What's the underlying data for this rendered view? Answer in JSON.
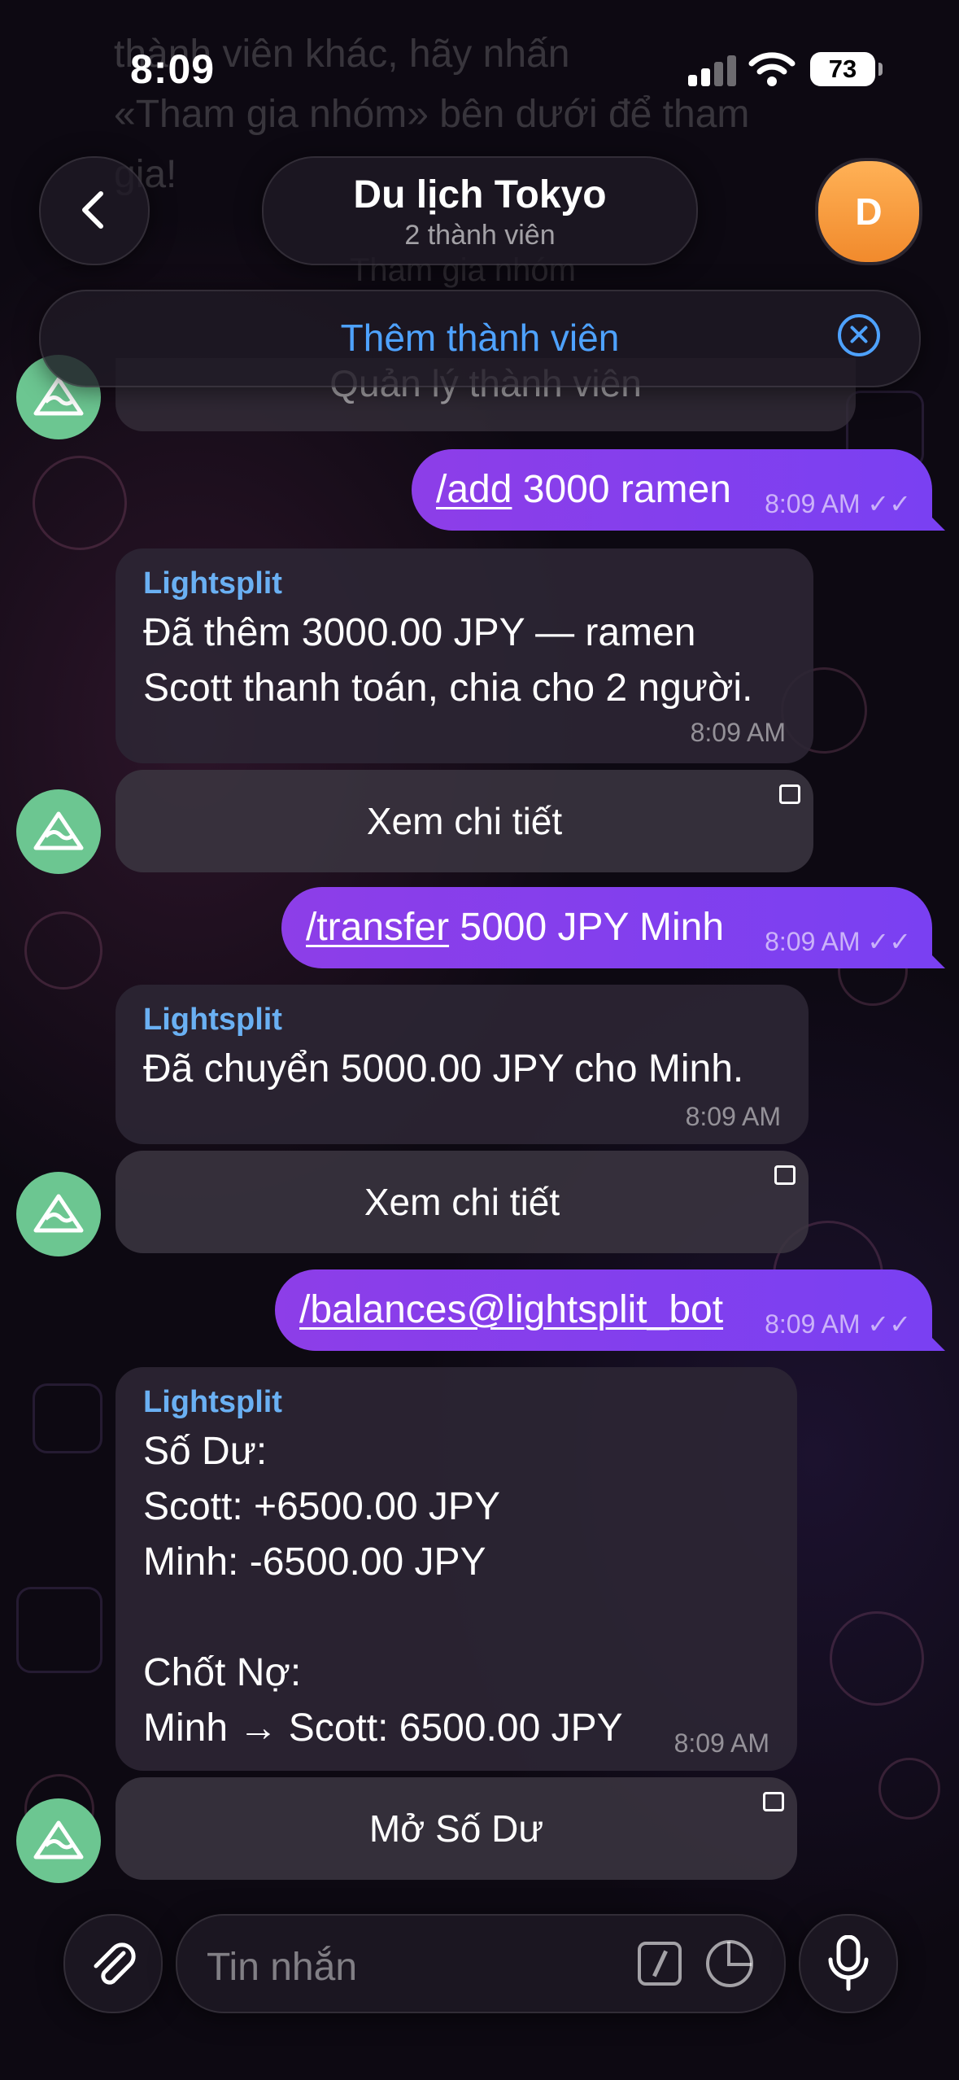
{
  "status_bar": {
    "time": "8:09",
    "battery": "73"
  },
  "pinned_ghost": {
    "line1": "thành viên khác, hãy nhấn",
    "line2": "«Tham gia nhóm» bên dưới để tham",
    "line3": "gia!",
    "button": "Tham gia nhóm"
  },
  "header": {
    "back_icon": "chevron-left-icon",
    "title": "Du lịch Tokyo",
    "subtitle": "2 thành viên",
    "avatar_letter": "D",
    "avatar_color": "#f5a042"
  },
  "add_member_bar": {
    "label": "Thêm thành viên",
    "close_icon": "close-circle-icon",
    "accent": "#4ea2ff"
  },
  "previous_button": {
    "label": "Quản lý thành viên"
  },
  "messages": [
    {
      "type": "outgoing",
      "command": "/add",
      "rest": " 3000 ramen",
      "time": "8:09 AM",
      "status_icon": "double-check-icon"
    },
    {
      "type": "incoming",
      "sender": "Lightsplit",
      "text": "Đã thêm 3000.00 JPY — ramen\nScott thanh toán, chia cho 2 người.",
      "time": "8:09 AM",
      "button": "Xem chi tiết"
    },
    {
      "type": "outgoing",
      "command": "/transfer",
      "rest": " 5000 JPY Minh",
      "time": "8:09 AM",
      "status_icon": "double-check-icon"
    },
    {
      "type": "incoming",
      "sender": "Lightsplit",
      "text": "Đã chuyển 5000.00 JPY cho Minh.",
      "time": "8:09 AM",
      "button": "Xem chi tiết"
    },
    {
      "type": "outgoing",
      "command": "/balances@lightsplit_bot",
      "rest": "",
      "time": "8:09 AM",
      "status_icon": "double-check-icon"
    },
    {
      "type": "incoming",
      "sender": "Lightsplit",
      "text": "Số Dư:\nScott: +6500.00 JPY\nMinh: -6500.00 JPY\n\nChốt Nợ:\nMinh → Scott: 6500.00 JPY",
      "time": "8:09 AM",
      "button": "Mở Số Dư"
    }
  ],
  "composer": {
    "placeholder": "Tin nhắn",
    "attach_icon": "paperclip-icon",
    "command_icon": "slash-command-icon",
    "sticker_icon": "sticker-icon",
    "mic_icon": "microphone-icon"
  },
  "colors": {
    "outgoing_bubble": "#8a3ef0",
    "sender_name": "#6ab0f3",
    "bot_avatar": "#6cc691"
  }
}
